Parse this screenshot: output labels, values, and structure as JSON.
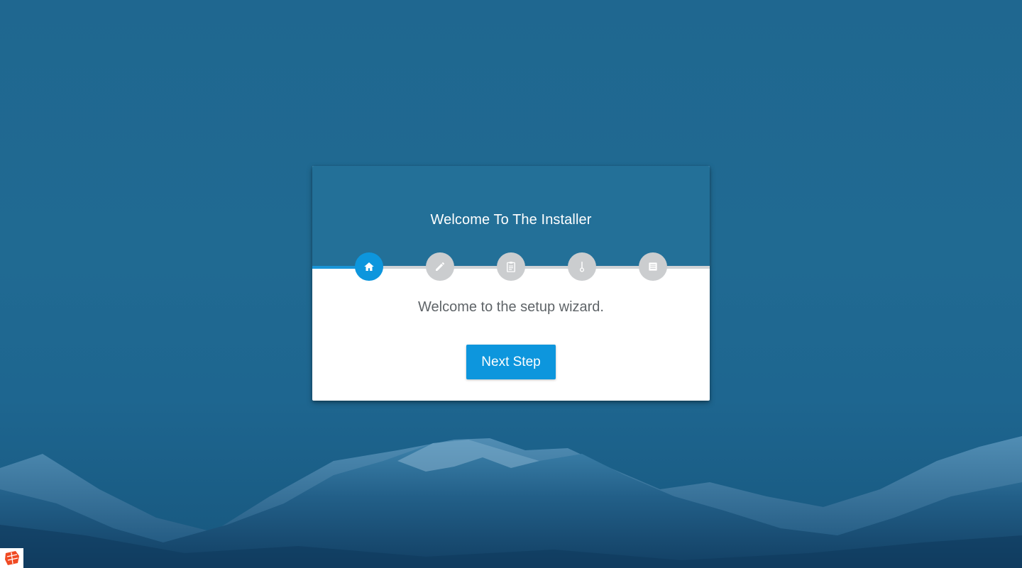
{
  "installer": {
    "title": "Welcome To The Installer",
    "welcome_message": "Welcome to the setup wizard.",
    "next_button_label": "Next Step",
    "progress_fraction": 0.125,
    "steps": [
      {
        "icon": "home-icon",
        "state": "active"
      },
      {
        "icon": "pencil-icon",
        "state": "inactive"
      },
      {
        "icon": "clipboard-icon",
        "state": "inactive"
      },
      {
        "icon": "thermometer-icon",
        "state": "inactive"
      },
      {
        "icon": "document-icon",
        "state": "inactive"
      }
    ]
  },
  "colors": {
    "background": "#206a92",
    "header": "#237098",
    "accent": "#0d96dd",
    "step_inactive": "#cbcdcf",
    "body_text": "#5f6468"
  },
  "corner_badge": {
    "icon": "app-logo-icon"
  }
}
